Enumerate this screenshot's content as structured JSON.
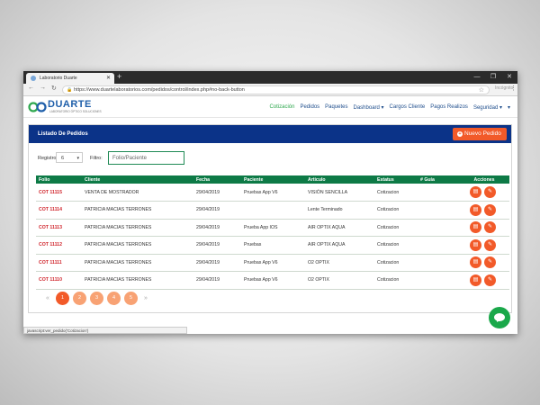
{
  "browser": {
    "tab_title": "Laboratorio Duarte",
    "tab_close": "✕",
    "new_tab": "+",
    "controls": {
      "minimize": "—",
      "maximize": "❐",
      "close": "✕"
    },
    "nav": {
      "back": "←",
      "forward": "→",
      "reload": "↻"
    },
    "url": "https://www.duartelaboratorios.com/pedidos/control/index.php#no-back-button",
    "profile": "Incógnito"
  },
  "logo": {
    "brand": "DUARTE",
    "tagline": "LABORATORIO ÓPTICO SOLUCIONES"
  },
  "nav": {
    "items": [
      {
        "label": "Cotización",
        "active": true
      },
      {
        "label": "Pedidos"
      },
      {
        "label": "Paquetes"
      },
      {
        "label": "Dashboard ▾"
      },
      {
        "label": "Cargos Cliente"
      },
      {
        "label": "Pagos Realizos"
      },
      {
        "label": "Seguridad ▾"
      },
      {
        "label": "▾"
      }
    ]
  },
  "panel": {
    "title": "Listado De Pedidos",
    "new_button": "Nuevo Pedido",
    "new_button_icon": "+"
  },
  "filters": {
    "registros_label": "Registro:",
    "registros_value": "6",
    "filtro_label": "Filtro:",
    "filtro_placeholder": "Folio/Paciente"
  },
  "table": {
    "headers": [
      "Folio",
      "Cliente",
      "Fecha",
      "Paciente",
      "Articulo",
      "Estatus",
      "# Guía",
      "Acciones"
    ],
    "rows": [
      {
        "folio": "COT 11115",
        "cliente": "VENTA DE MOSTRADOR",
        "fecha": "29/04/2019",
        "paciente": "Pruebas App V6",
        "articulo": "VISIÓN SENCILLA",
        "estatus": "Cotizacion",
        "guia": ""
      },
      {
        "folio": "COT 11114",
        "cliente": "PATRICIA MACIAS TERRONES",
        "fecha": "29/04/2019",
        "paciente": "",
        "articulo": "Lente Terminado",
        "estatus": "Cotizacion",
        "guia": ""
      },
      {
        "folio": "COT 11113",
        "cliente": "PATRICIA MACIAS TERRONES",
        "fecha": "29/04/2019",
        "paciente": "Prueba App IOS",
        "articulo": "AIR OPTIX AQUA",
        "estatus": "Cotizacion",
        "guia": ""
      },
      {
        "folio": "COT 11112",
        "cliente": "PATRICIA MACIAS TERRONES",
        "fecha": "29/04/2019",
        "paciente": "Pruebas",
        "articulo": "AIR OPTIX AQUA",
        "estatus": "Cotizacion",
        "guia": ""
      },
      {
        "folio": "COT 11111",
        "cliente": "PATRICIA MACIAS TERRONES",
        "fecha": "29/04/2019",
        "paciente": "Pruebas App V6",
        "articulo": "O2 OPTIX",
        "estatus": "Cotizacion",
        "guia": ""
      },
      {
        "folio": "COT 11110",
        "cliente": "PATRICIA MACIAS TERRONES",
        "fecha": "29/04/2019",
        "paciente": "Pruebas App V6",
        "articulo": "O2 OPTIX",
        "estatus": "Cotizacion",
        "guia": ""
      }
    ],
    "action_icons": {
      "pdf": "▤",
      "edit": "✎"
    }
  },
  "pager": {
    "prev": "«",
    "next": "»",
    "pages": [
      "1",
      "2",
      "3",
      "4",
      "5"
    ],
    "current": "1"
  },
  "statusbar": "javascript:ver_pedido('Cotizacion')",
  "colors": {
    "header_blue": "#0b3388",
    "table_green": "#0d7a46",
    "accent_orange": "#f25a29",
    "folio_red": "#d0252c",
    "chat_green": "#1aa84a"
  }
}
